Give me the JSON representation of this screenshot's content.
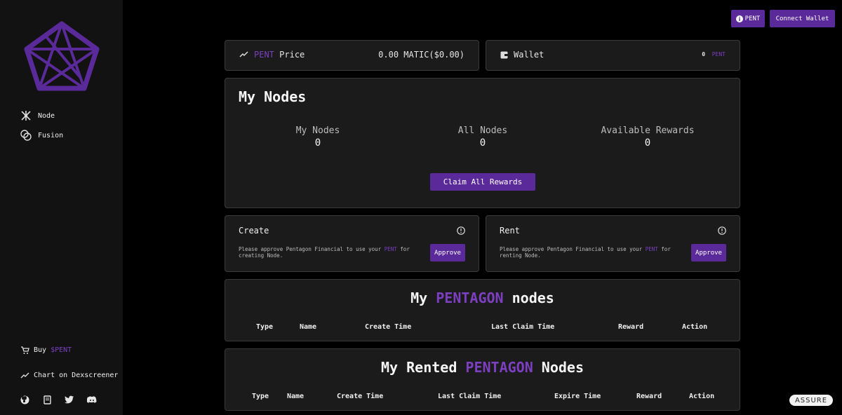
{
  "sidebar": {
    "nav": [
      {
        "label": "Node",
        "icon": "node-icon"
      },
      {
        "label": "Fusion",
        "icon": "fusion-icon"
      }
    ],
    "buy": {
      "label": "Buy",
      "token": "$PENT",
      "icon": "cart-icon"
    },
    "chart": {
      "label": "Chart on Dexscreener",
      "icon": "chart-trend-icon"
    },
    "socials": [
      "github-icon",
      "docs-icon",
      "twitter-icon",
      "discord-icon"
    ]
  },
  "topbar": {
    "pent_button": "PENT",
    "connect_button": "Connect Wallet"
  },
  "price": {
    "token": "PENT",
    "label": "Price",
    "value": "0.00 MATIC($0.00)"
  },
  "wallet": {
    "label": "Wallet",
    "amount": "0",
    "token": "PENT"
  },
  "my_nodes": {
    "title": "My Nodes",
    "stats": [
      {
        "label": "My Nodes",
        "value": "0"
      },
      {
        "label": "All Nodes",
        "value": "0"
      },
      {
        "label": "Available Rewards",
        "value": "0"
      }
    ],
    "claim_button": "Claim All Rewards"
  },
  "create": {
    "title": "Create",
    "desc_before": "Please approve Pentagon Financial to use your ",
    "desc_token": "PENT",
    "desc_after": " for creating Node.",
    "button": "Approve"
  },
  "rent": {
    "title": "Rent",
    "desc_before": "Please approve Pentagon Financial to use your ",
    "desc_token": "PENT",
    "desc_after": " for renting Node.",
    "button": "Approve"
  },
  "pentagon_nodes": {
    "title_before": "My",
    "title_accent": "PENTAGON",
    "title_after": "nodes",
    "columns": [
      "Type",
      "Name",
      "Create Time",
      "Last Claim Time",
      "Reward",
      "Action"
    ]
  },
  "rented_nodes": {
    "title_before": "My Rented",
    "title_accent": "PENTAGON",
    "title_after": "Nodes",
    "columns": [
      "Type",
      "Name",
      "Create Time",
      "Last Claim Time",
      "Expire Time",
      "Reward",
      "Action"
    ]
  },
  "badge": "ASSURE",
  "colors": {
    "accent": "#5b2a9a",
    "accent_text": "#7b3fbf",
    "card": "#1b1b1b",
    "sidebar": "#121212"
  }
}
